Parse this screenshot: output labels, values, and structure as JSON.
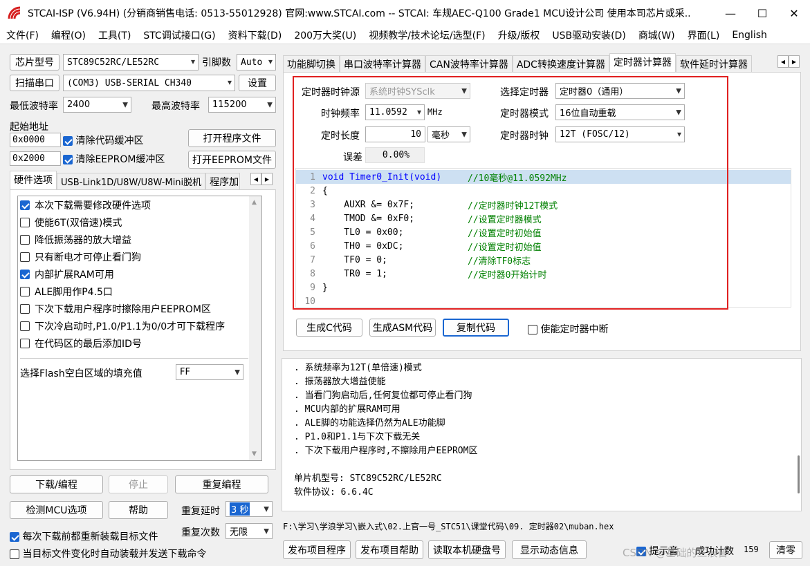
{
  "window": {
    "title": "STCAI-ISP (V6.94H) (分销商销售电话: 0513-55012928) 官网:www.STCAI.com  -- STCAI: 车规AEC-Q100 Grade1 MCU设计公司 使用本司芯片或采...",
    "minimize": "—",
    "maximize": "☐",
    "close": "✕"
  },
  "menu": [
    "文件(F)",
    "编程(O)",
    "工具(T)",
    "STC调试接口(G)",
    "资料下载(D)",
    "200万大奖(U)",
    "视频教学/技术论坛/选型(F)",
    "升级/版权",
    "USB驱动安装(D)",
    "商城(W)",
    "界面(L)",
    "English"
  ],
  "left": {
    "chip_button": "芯片型号",
    "chip_value": "STC89C52RC/LE52RC",
    "pins_label": "引脚数",
    "pins_value": "Auto",
    "scan_button": "扫描串口",
    "port_value": "(COM3) USB-SERIAL CH340",
    "settings_button": "设置",
    "min_baud_label": "最低波特率",
    "min_baud": "2400",
    "max_baud_label": "最高波特率",
    "max_baud": "115200",
    "start_addr_label": "起始地址",
    "addr1": "0x0000",
    "clear_code": "清除代码缓冲区",
    "open_prog": "打开程序文件",
    "addr2": "0x2000",
    "clear_eeprom": "清除EEPROM缓冲区",
    "open_eeprom": "打开EEPROM文件",
    "tabs": [
      "硬件选项",
      "USB-Link1D/U8W/U8W-Mini脱机",
      "程序加"
    ],
    "hw_options": [
      {
        "label": "本次下载需要修改硬件选项",
        "checked": true
      },
      {
        "label": "使能6T(双倍速)模式",
        "checked": false
      },
      {
        "label": "降低振荡器的放大增益",
        "checked": false
      },
      {
        "label": "只有断电才可停止看门狗",
        "checked": false
      },
      {
        "label": "内部扩展RAM可用",
        "checked": true
      },
      {
        "label": "ALE脚用作P4.5口",
        "checked": false
      },
      {
        "label": "下次下载用户程序时擦除用户EEPROM区",
        "checked": false
      },
      {
        "label": "下次冷启动时,P1.0/P1.1为0/0才可下载程序",
        "checked": false
      },
      {
        "label": "在代码区的最后添加ID号",
        "checked": false
      }
    ],
    "flash_fill_label": "选择Flash空白区域的填充值",
    "flash_fill": "FF",
    "download_button": "下载/编程",
    "stop_button": "停止",
    "reprogram_button": "重复编程",
    "detect_button": "检测MCU选项",
    "help_button": "帮助",
    "repeat_delay_label": "重复延时",
    "repeat_delay": "3 秒",
    "reload_label": "每次下载前都重新装载目标文件",
    "repeat_count_label": "重复次数",
    "repeat_count": "无限",
    "auto_label": "当目标文件变化时自动装载并发送下载命令"
  },
  "right": {
    "tabs": [
      "功能脚切换",
      "串口波特率计算器",
      "CAN波特率计算器",
      "ADC转换速度计算器",
      "定时器计算器",
      "软件延时计算器"
    ],
    "clock_src_label": "定时器时钟源",
    "clock_src": "系统时钟SYSclk",
    "sel_timer_label": "选择定时器",
    "sel_timer": "定时器0（通用）",
    "freq_label": "时钟频率",
    "freq": "11.0592",
    "freq_unit": "MHz",
    "mode_label": "定时器模式",
    "mode": "16位自动重载",
    "len_label": "定时长度",
    "len": "10",
    "len_unit": "毫秒",
    "tclk_label": "定时器时钟",
    "tclk": "12T (FOSC/12)",
    "err_label": "误差",
    "err": "0.00%",
    "code": [
      {
        "n": "1",
        "code": "void Timer0_Init(void)",
        "comment": "//10毫秒@11.0592MHz"
      },
      {
        "n": "2",
        "code": "{",
        "comment": ""
      },
      {
        "n": "3",
        "code": "    AUXR &= 0x7F;",
        "comment": "//定时器时钟12T模式"
      },
      {
        "n": "4",
        "code": "    TMOD &= 0xF0;",
        "comment": "//设置定时器模式"
      },
      {
        "n": "5",
        "code": "    TL0 = 0x00;",
        "comment": "//设置定时初始值"
      },
      {
        "n": "6",
        "code": "    TH0 = 0xDC;",
        "comment": "//设置定时初始值"
      },
      {
        "n": "7",
        "code": "    TF0 = 0;",
        "comment": "//清除TF0标志"
      },
      {
        "n": "8",
        "code": "    TR0 = 1;",
        "comment": "//定时器0开始计时"
      },
      {
        "n": "9",
        "code": "}",
        "comment": ""
      },
      {
        "n": "10",
        "code": "",
        "comment": ""
      }
    ],
    "gen_c": "生成C代码",
    "gen_asm": "生成ASM代码",
    "copy_code": "复制代码",
    "enable_int": "使能定时器中断",
    "log": [
      ". 系统频率为12T(单倍速)模式",
      ". 振荡器放大增益使能",
      ". 当看门狗启动后,任何复位都可停止看门狗",
      ". MCU内部的扩展RAM可用",
      ". ALE脚的功能选择仍然为ALE功能脚",
      ". P1.0和P1.1与下次下载无关",
      ". 下次下载用户程序时,不擦除用户EEPROM区",
      "",
      "单片机型号: STC89C52RC/LE52RC",
      "软件协议: 6.6.4C"
    ],
    "file_path": "F:\\学习\\学浪学习\\嵌入式\\02.上官一号_STC51\\课堂代码\\09. 定时器02\\muban.hex",
    "publish_prog": "发布项目程序",
    "publish_help": "发布项目帮助",
    "read_disk": "读取本机硬盘号",
    "show_dyn": "显示动态信息",
    "prompt_label": "提示音",
    "count_label": "成功计数",
    "count": "159",
    "clear_label": "清零",
    "watermark": "CSDN @基础的三浪普"
  }
}
